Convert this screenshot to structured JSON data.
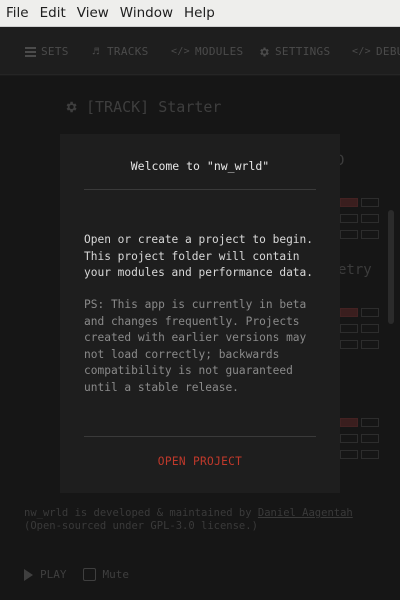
{
  "menubar": {
    "items": [
      "File",
      "Edit",
      "View",
      "Window",
      "Help"
    ]
  },
  "nav": {
    "sets": "SETS",
    "tracks": "TRACKS",
    "modules": "MODULES",
    "settings": "SETTINGS",
    "debug": "DEBUG"
  },
  "background": {
    "track_title": "[TRACK] Starter",
    "ghost_1": "D",
    "ghost_2": "etry",
    "footer_line1_prefix": "nw_wrld is developed & maintained by ",
    "footer_author": "Daniel Aagentah",
    "footer_line2": "(Open-sourced under GPL-3.0 license.)"
  },
  "player": {
    "play_label": "PLAY",
    "mute_label": "Mute"
  },
  "modal": {
    "title": "Welcome to \"nw_wrld\"",
    "body": "Open or create a project to begin. This project folder will contain your modules and performance data.",
    "ps": "PS: This app is currently in beta and changes frequently. Projects created with earlier versions may not load correctly; backwards compatibility is not guaranteed until a stable release.",
    "button": "OPEN PROJECT"
  },
  "colors": {
    "accent_red": "#c0392b",
    "modal_bg": "#1e1e1e",
    "app_bg": "#161616"
  }
}
